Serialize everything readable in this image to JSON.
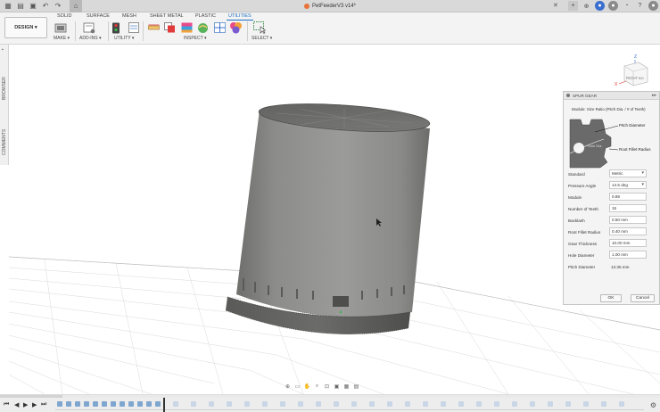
{
  "window": {
    "title": "PetFeederV3 v14*"
  },
  "toolbar": {
    "workspace_button": "DESIGN ▾",
    "tabs": [
      "SOLID",
      "SURFACE",
      "MESH",
      "SHEET METAL",
      "PLASTIC",
      "UTILITIES"
    ],
    "active_tab": "UTILITIES",
    "groups": {
      "make": "MAKE ▾",
      "addins": "ADD-INS ▾",
      "utility": "UTILITY ▾",
      "inspect": "INSPECT ▾",
      "select": "SELECT ▾"
    }
  },
  "side_tabs": {
    "browser": "BROWSER",
    "comments": "COMMENTS"
  },
  "viewcube": {
    "face_label": "RIGHT",
    "back_label": "BO",
    "axis_z": "Z",
    "axis_x": "X"
  },
  "spur_gear_panel": {
    "title": "SPUR GEAR",
    "caption": "Module: Size Ratio (Pitch Dia. / # of Teeth)",
    "diagram_labels": {
      "pitch_diameter": "Pitch Diameter",
      "root_fillet_radius": "Root Fillet Radius",
      "hole_dia": "Hole Dia."
    },
    "fields": [
      {
        "label": "Standard",
        "value": "Metric",
        "type": "select"
      },
      {
        "label": "Pressure Angle",
        "value": "14.5 deg",
        "type": "select"
      },
      {
        "label": "Module",
        "value": "0.89",
        "type": "input"
      },
      {
        "label": "Number of Teeth",
        "value": "15",
        "type": "input"
      },
      {
        "label": "Backlash",
        "value": "0.50 mm",
        "type": "input"
      },
      {
        "label": "Root Fillet Radius",
        "value": "0.40 mm",
        "type": "input"
      },
      {
        "label": "Gear Thickness",
        "value": "10.00 mm",
        "type": "input"
      },
      {
        "label": "Hole Diameter",
        "value": "1.00 mm",
        "type": "input"
      },
      {
        "label": "Pitch Diameter",
        "value": "13.35 mm",
        "type": "readonly"
      }
    ],
    "ok_label": "OK",
    "cancel_label": "Cancel"
  },
  "colors": {
    "accent": "#1f70c1",
    "body_gray": "#8e8e8c",
    "title_dot": "#e8733a"
  }
}
